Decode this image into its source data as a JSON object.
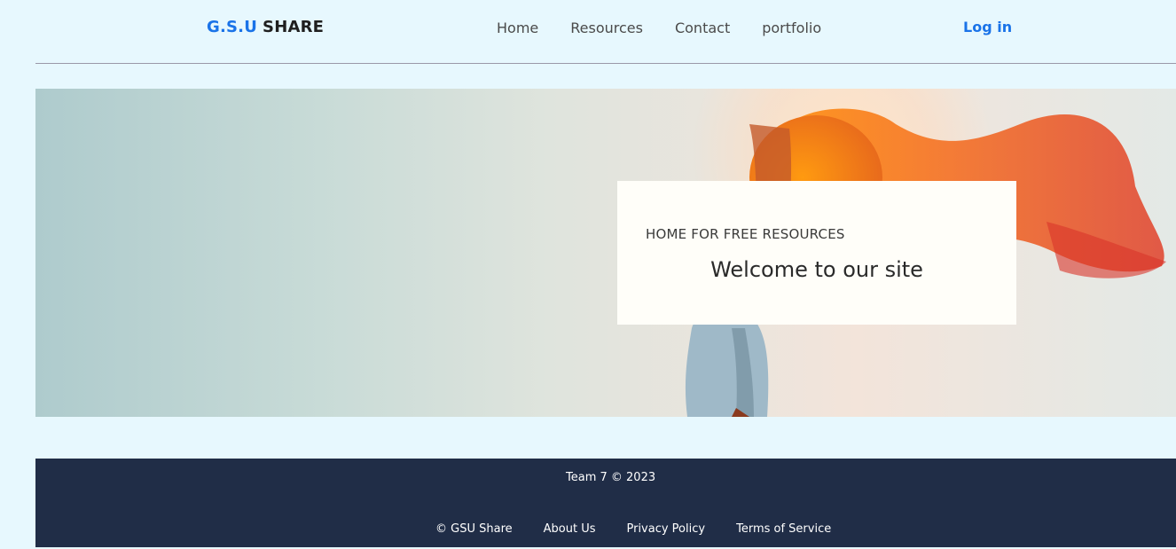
{
  "header": {
    "brand_part1": "G.S.U",
    "brand_part2": "SHARE",
    "nav": [
      "Home",
      "Resources",
      "Contact",
      "portfolio"
    ],
    "login_label": "Log in"
  },
  "hero": {
    "eyebrow": "HOME FOR FREE RESOURCES",
    "headline": "Welcome to our site"
  },
  "footer": {
    "copyright": "Team 7 © 2023",
    "links": [
      "© GSU Share",
      "About Us",
      "Privacy Policy",
      "Terms of Service"
    ]
  },
  "colors": {
    "page_background": "#e7f8fe",
    "brand_accent": "#1a73e8",
    "footer_background": "#202d47"
  }
}
